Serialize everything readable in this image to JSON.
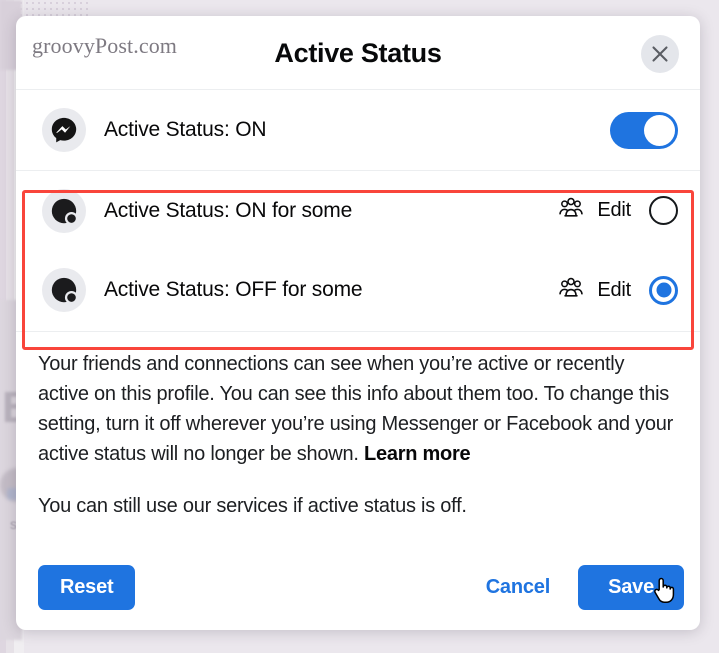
{
  "backdrop": {
    "letter": "B",
    "side_text": "s"
  },
  "modal": {
    "watermark": "groovyPost.com",
    "title": "Active Status",
    "close_icon": "close-icon",
    "options": [
      {
        "icon": "messenger-icon",
        "label": "Active Status: ON",
        "control": "toggle",
        "toggle_on": true
      },
      {
        "icon": "person-status-icon",
        "label": "Active Status: ON for some",
        "people_icon": "people-group-icon",
        "edit_label": "Edit",
        "control": "radio",
        "selected": false
      },
      {
        "icon": "person-status-icon",
        "label": "Active Status: OFF for some",
        "people_icon": "people-group-icon",
        "edit_label": "Edit",
        "control": "radio",
        "selected": true
      }
    ],
    "body": {
      "paragraph_1_before_link": "Your friends and connections can see when you’re active or recently active on this profile. You can see this info about them too. To change this setting, turn it off wherever you’re using Messenger or Facebook and your active status will no longer be shown. ",
      "learn_more": "Learn more",
      "paragraph_2": "You can still use our services if active status is off."
    },
    "footer": {
      "reset_label": "Reset",
      "cancel_label": "Cancel",
      "save_label": "Save"
    }
  },
  "annotation": {
    "highlight_color": "#f9453b"
  },
  "colors": {
    "accent_blue": "#1f74e0",
    "toggle_on": "#1f74e0",
    "radio_selected": "#1f74e0",
    "page_background": "#e8e2ea",
    "modal_background": "#ffffff",
    "icon_bubble": "#e9eaee",
    "close_bubble": "#e4e6eb"
  },
  "cursor": {
    "type": "pointer-hand",
    "over": "Save"
  }
}
